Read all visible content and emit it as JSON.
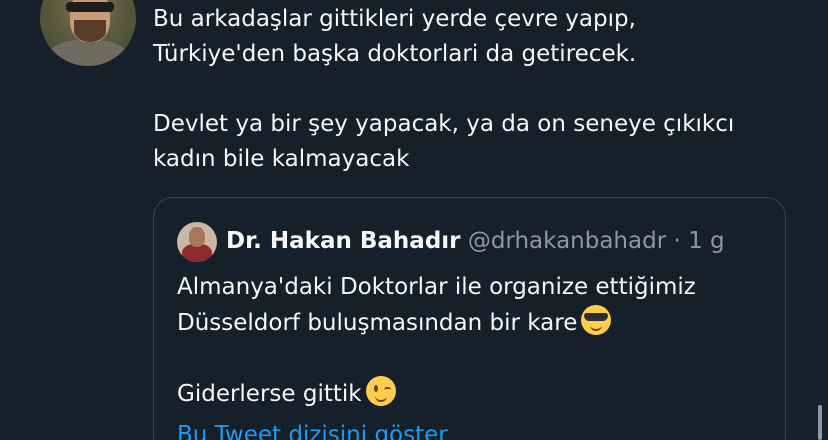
{
  "tweet": {
    "text": "Bu arkadaşlar gittikleri yerde çevre yapıp,\nTürkiye'den başka doktorlari da getirecek.\n\nDevlet ya bir şey yapacak, ya da on seneye çıkıkcı\nkadın bile kalmayacak"
  },
  "quote": {
    "name": "Dr. Hakan Bahadır",
    "handle": "@drhakanbahadr",
    "separator": "·",
    "time": "1 g",
    "text_line1": "Almanya'daki Doktorlar ile organize ettiğimiz\nDüsseldorf buluşmasından bir kare",
    "text_line2": "\n\nGiderlerse gittik",
    "show_thread": "Bu Tweet dizisini göster"
  },
  "colors": {
    "background": "#15202b",
    "text": "#f7f9f9",
    "muted": "#8b98a5",
    "link": "#1d9bf0",
    "border": "#38444d"
  }
}
